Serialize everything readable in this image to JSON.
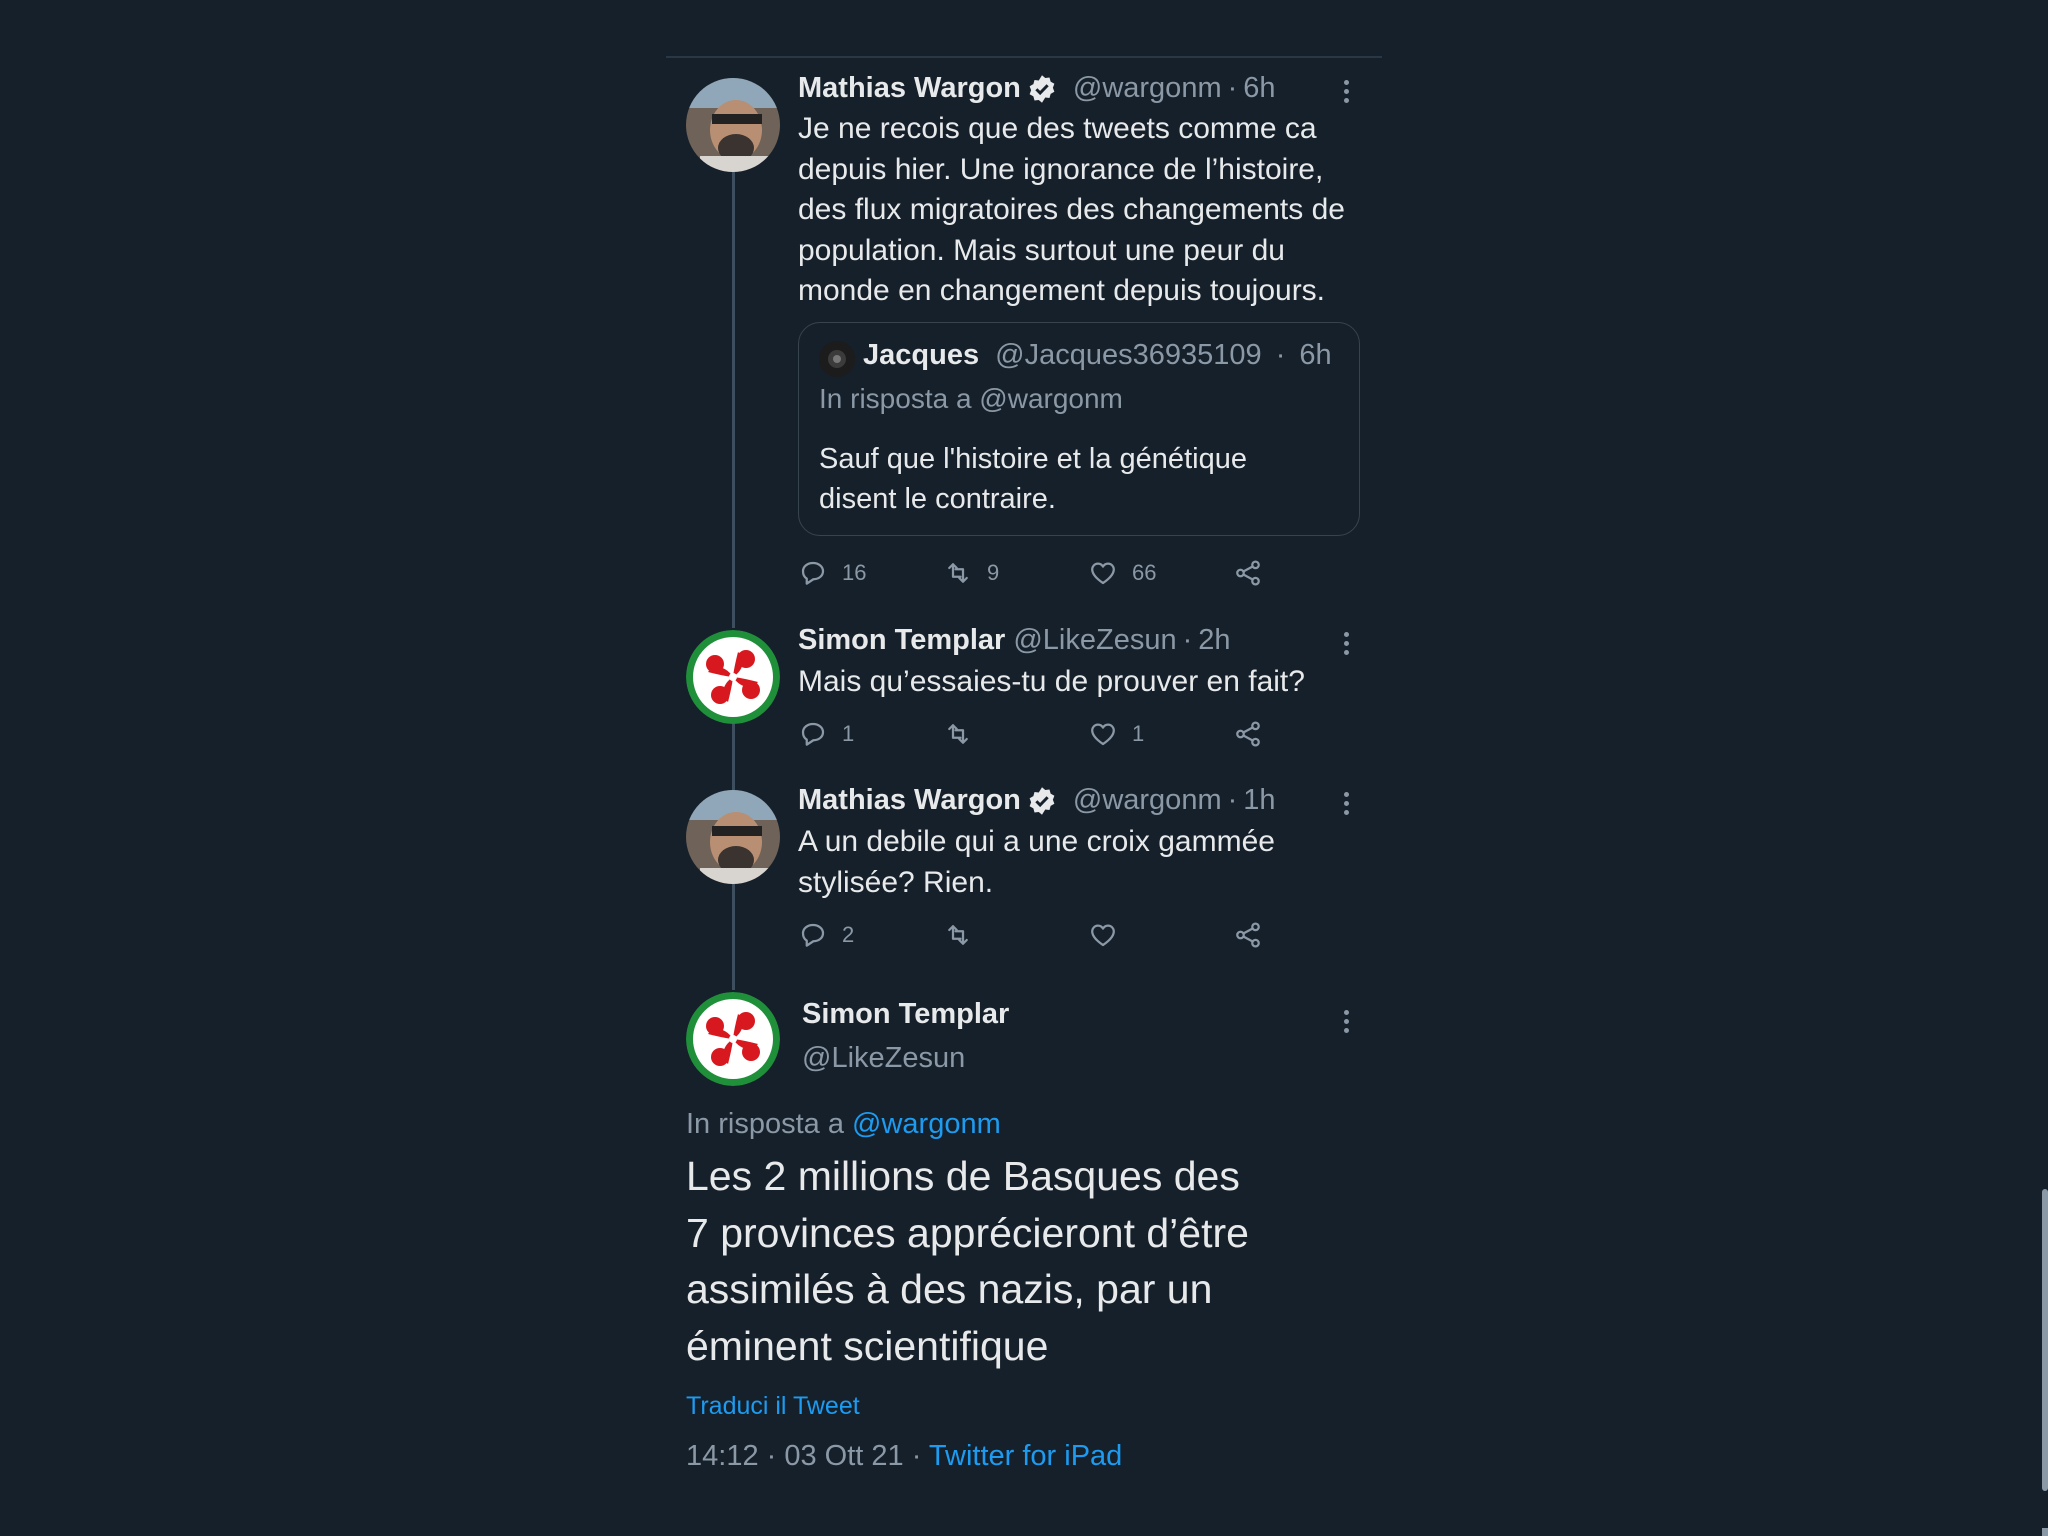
{
  "tweets": [
    {
      "name": "Mathias Wargon",
      "verified": true,
      "handle": "@wargonm",
      "separator": "·",
      "time": "6h",
      "text_lines": [
        "Je ne recois que des tweets comme ca",
        "depuis hier. Une ignorance de l’histoire,",
        "des flux migratoires des changements de",
        "population. Mais surtout une peur du",
        "monde en changement depuis toujours."
      ],
      "quote": {
        "name": "Jacques",
        "handle": "@Jacques36935109",
        "separator": "·",
        "time": "6h",
        "reply_to": "In risposta a @wargonm",
        "text_lines": [
          "Sauf que l'histoire et la génétique",
          "disent le contraire."
        ]
      },
      "replies": "16",
      "retweets": "9",
      "likes": "66"
    },
    {
      "name": "Simon Templar",
      "handle": "@LikeZesun",
      "separator": "·",
      "time": "2h",
      "text_lines": [
        "Mais qu’essaies-tu de prouver en fait?"
      ],
      "replies": "1",
      "retweets": "",
      "likes": "1"
    },
    {
      "name": "Mathias Wargon",
      "verified": true,
      "handle": "@wargonm",
      "separator": "·",
      "time": "1h",
      "text_lines": [
        "A un debile qui a une croix gammée",
        "stylisée? Rien."
      ],
      "replies": "2",
      "retweets": "",
      "likes": ""
    }
  ],
  "main_tweet": {
    "name": "Simon Templar",
    "handle": "@LikeZesun",
    "reply_prefix": "In risposta a",
    "reply_handle": "@wargonm",
    "text_lines": [
      "Les 2 millions de Basques des",
      "7 provinces apprécieront d’être",
      "assimilés à des nazis, par un",
      "éminent scientifique"
    ],
    "translate": "Traduci il Tweet",
    "timestamp": "14:12 · 03 Ott 21 · ",
    "source": "Twitter for iPad"
  },
  "colors": {
    "background": "#15202b",
    "text": "#e7e9ea",
    "secondary": "#8b98a5",
    "link": "#1d9bf0",
    "verified": "#e7e9ea"
  },
  "icons": [
    "verified-badge-icon",
    "reply-icon",
    "retweet-icon",
    "like-icon",
    "share-icon",
    "more-icon"
  ]
}
